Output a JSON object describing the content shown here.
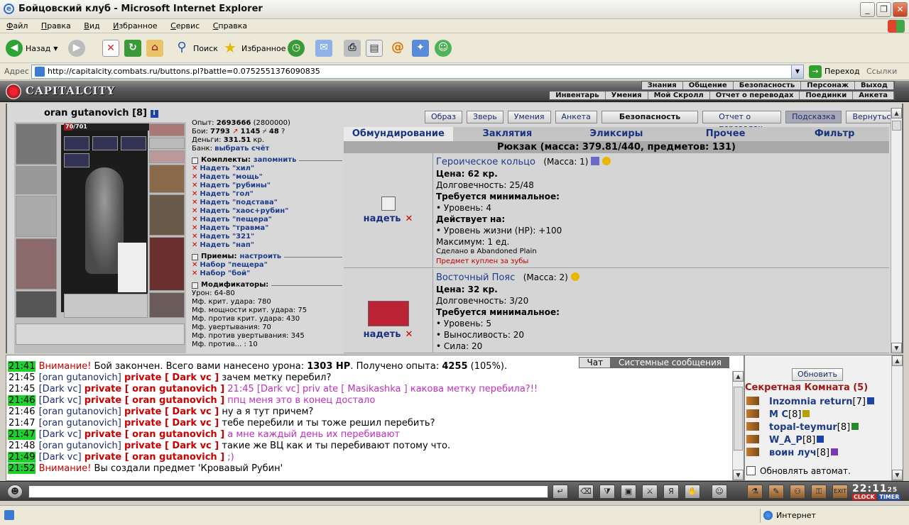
{
  "window": {
    "title": "Бойцовский клуб - Microsoft Internet Explorer"
  },
  "menu": [
    "Файл",
    "Правка",
    "Вид",
    "Избранное",
    "Сервис",
    "Справка"
  ],
  "toolbar": {
    "back": "Назад",
    "search": "Поиск",
    "favorites": "Избранное"
  },
  "address": {
    "label": "Адрес",
    "url": "http://capitalcity.combats.ru/buttons.pl?battle=0.0752551376090835",
    "go": "Переход",
    "links": "Ссылки"
  },
  "game_header": {
    "logo": "CAPITALCITY",
    "nav_top": [
      "Знания",
      "Общение",
      "Безопасность",
      "Персонаж",
      "Выход"
    ],
    "nav_bottom": [
      "Инвентарь",
      "Умения",
      "Мой Скролл",
      "Отчет о переводах",
      "Поединки",
      "Анкета"
    ]
  },
  "character": {
    "name": "oran gutanovich",
    "level": "[8]",
    "hp": "70/701",
    "hp_fraction": 0.1
  },
  "stats": {
    "exp_label": "Опыт:",
    "exp": "2693666",
    "exp_next": "(2800000)",
    "fights_label": "Бои:",
    "wins": "7793",
    "losses": "1145",
    "draws": "48",
    "money_label": "Деньги:",
    "money": "331.51",
    "money_unit": "кр.",
    "bank_label": "Банк:",
    "bank_link": "выбрать счёт"
  },
  "sets": {
    "title": "Комплекты:",
    "remember": "запомнить",
    "items": [
      "Надеть \"хил\"",
      "Надеть \"мощь\"",
      "Надеть \"рубины\"",
      "Надеть \"гол\"",
      "Надеть \"подстава\"",
      "Надеть \"хаос+рубин\"",
      "Надеть \"пещера\"",
      "Надеть \"травма\"",
      "Надеть \"321\"",
      "Надеть \"нап\""
    ]
  },
  "techniques": {
    "title": "Приемы:",
    "configure": "настроить",
    "items": [
      "Набор \"пещера\"",
      "Набор \"бой\""
    ]
  },
  "modifiers": {
    "title": "Модификаторы:",
    "items": [
      "Урон: 64-80",
      "Мф. крит. удара: 780",
      "Мф. мощности крит. удара: 75",
      "Мф. против крит. удара: 430",
      "Мф. увертывания: 70",
      "Мф. против увертывания: 345",
      "Мф. против... : 10"
    ]
  },
  "top_buttons": [
    "Образ",
    "Зверь",
    "Умения",
    "Анкета",
    "Безопасность",
    "Отчет о переводах",
    "Подсказка",
    "Вернуться"
  ],
  "tabs": [
    "Обмундирование",
    "Заклятия",
    "Эликсиры",
    "Прочее",
    "Фильтр"
  ],
  "backpack": {
    "title": "Рюкзак (масса: 379.81/440, предметов: 131)"
  },
  "items": [
    {
      "name": "Героическое кольцо",
      "mass": "(Масса: 1)",
      "price": "Цена: 62 кр.",
      "durability": "Долговечность: 25/48",
      "req_title": "Требуется минимальное:",
      "req": [
        "• Уровень: 4"
      ],
      "effect_title": "Действует на:",
      "effects": [
        "• Уровень жизни (HP): +100"
      ],
      "max": "Максимум: 1 ед.",
      "made": "Сделано в Abandoned Plain",
      "note": "Предмет куплен за зубы",
      "wear": "надеть"
    },
    {
      "name": "Восточный Пояс",
      "mass": "(Масса: 2)",
      "price": "Цена: 32 кр.",
      "durability": "Долговечность: 3/20",
      "req_title": "Требуется минимальное:",
      "req": [
        "• Уровень: 5",
        "• Выносливость: 20",
        "• Сила: 20"
      ],
      "wear": "надеть"
    }
  ],
  "chat": {
    "tabs": [
      "Чат",
      "Системные сообщения"
    ],
    "lines": [
      {
        "t": "21:41",
        "g": true,
        "warn": "Внимание!",
        "text": " Бой закончен. Всего вами нанесено урона: ",
        "b1": "1303 HP",
        "text2": ". Получено опыта: ",
        "b2": "4255",
        "text3": " (105%)."
      },
      {
        "t": "21:45",
        "from": "[oran gutanovich]",
        "priv": "private [ Dark vc ]",
        "msg": " зачем метку перебил?"
      },
      {
        "t": "21:45",
        "from": "[Dark vc]",
        "priv": "private [ oran gutanovich ]",
        "msg": " 21:45 [Dark vc] priv ate [ Masikashka ] какова метку перебила?!!",
        "magenta": true
      },
      {
        "t": "21:46",
        "g": true,
        "from": "[Dark vc]",
        "priv": "private [ oran gutanovich ]",
        "msg": " ппц меня это в конец достало",
        "magenta": true
      },
      {
        "t": "21:46",
        "from": "[oran gutanovich]",
        "priv": "private [ Dark vc ]",
        "msg": " ну а я тут причем?"
      },
      {
        "t": "21:47",
        "from": "[oran gutanovich]",
        "priv": "private [ Dark vc ]",
        "msg": " тебе перебили и ты тоже решил перебить?"
      },
      {
        "t": "21:47",
        "g": true,
        "from": "[Dark vc]",
        "priv": "private [ oran gutanovich ]",
        "msg": " а мне каждый день их перебивают",
        "magenta": true
      },
      {
        "t": "21:48",
        "from": "[oran gutanovich]",
        "priv": "private [ Dark vc ]",
        "msg": " такие же ВЦ как и ты перебивают потому что."
      },
      {
        "t": "21:49",
        "g": true,
        "from": "[Dark vc]",
        "priv": "private [ oran gutanovich ]",
        "msg": " ;)",
        "magenta": true
      },
      {
        "t": "21:52",
        "g": true,
        "warn": "Внимание!",
        "text": " Вы создали предмет 'Кровавый Рубин'"
      }
    ]
  },
  "room": {
    "refresh": "Обновить",
    "title": "Секретная Комната (5)",
    "users": [
      {
        "name": "Inzomnia return",
        "lvl": "[7]"
      },
      {
        "name": "M C",
        "lvl": "[8]"
      },
      {
        "name": "topal-teymur",
        "lvl": "[8]"
      },
      {
        "name": "W_A_P",
        "lvl": "[8]"
      },
      {
        "name": "воин луч",
        "lvl": "[8]"
      }
    ],
    "auto": "Обновлять автомат."
  },
  "clock": {
    "time": "22:11",
    "sec": "25",
    "label1": "CLOCK",
    "label2": "TIMER"
  },
  "status": {
    "zone": "Интернет"
  }
}
